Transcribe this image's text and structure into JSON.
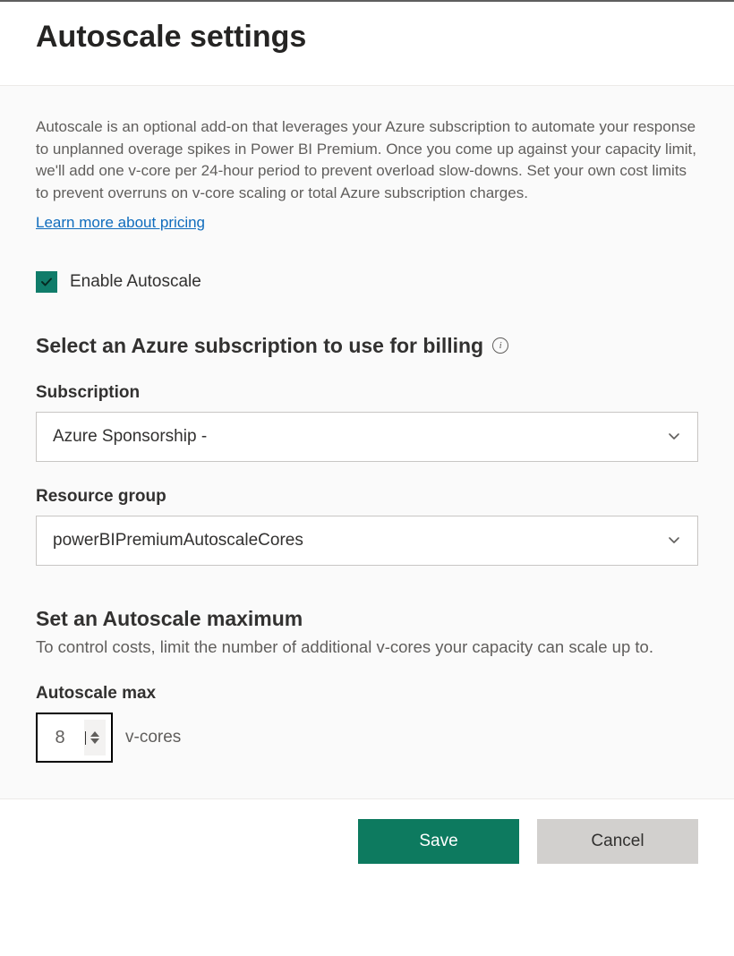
{
  "header": {
    "title": "Autoscale settings"
  },
  "description": "Autoscale is an optional add-on that leverages your Azure subscription to automate your response to unplanned overage spikes in Power BI Premium. Once you come up against your capacity limit, we'll add one v-core per 24-hour period to prevent overload slow-downs. Set your own cost limits to prevent overruns on v-core scaling or total Azure subscription charges.",
  "learn_link": "Learn more about pricing",
  "enable": {
    "label": "Enable Autoscale",
    "checked": true
  },
  "billing": {
    "heading": "Select an Azure subscription to use for billing",
    "subscription_label": "Subscription",
    "subscription_value": "Azure Sponsorship -",
    "resource_group_label": "Resource group",
    "resource_group_value": "powerBIPremiumAutoscaleCores"
  },
  "max": {
    "heading": "Set an Autoscale maximum",
    "description": "To control costs, limit the number of additional v-cores your capacity can scale up to.",
    "label": "Autoscale max",
    "value": "8",
    "unit": "v-cores"
  },
  "actions": {
    "save": "Save",
    "cancel": "Cancel"
  }
}
